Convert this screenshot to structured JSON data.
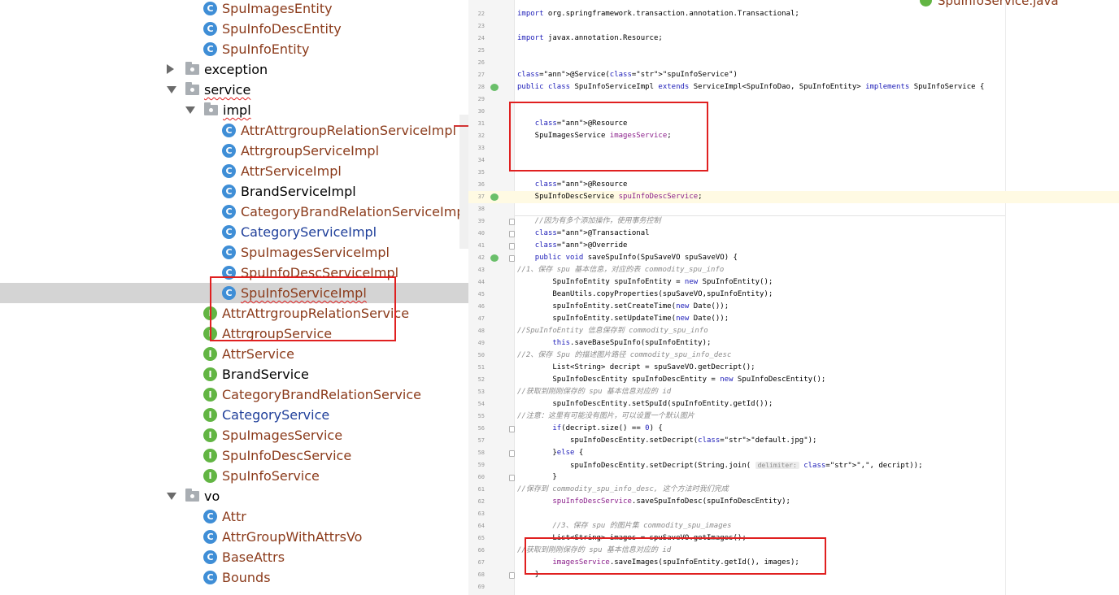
{
  "tree": {
    "rows": [
      {
        "label": "SpuImagesEntity",
        "icon": "class-icon",
        "color": "brown"
      },
      {
        "label": "SpuInfoDescEntity",
        "icon": "class-icon",
        "color": "brown"
      },
      {
        "label": "SpuInfoEntity",
        "icon": "class-icon",
        "color": "brown"
      },
      {
        "label": "exception",
        "icon": "folder-icon",
        "color": "black",
        "arrow": "right"
      },
      {
        "label": "service",
        "icon": "folder-icon",
        "color": "black",
        "arrow": "down"
      },
      {
        "label": "impl",
        "icon": "folder-icon",
        "color": "black",
        "arrow": "down"
      },
      {
        "label": "AttrAttrgroupRelationServiceImpl",
        "icon": "class-icon",
        "color": "brown"
      },
      {
        "label": "AttrgroupServiceImpl",
        "icon": "class-icon",
        "color": "brown"
      },
      {
        "label": "AttrServiceImpl",
        "icon": "class-icon",
        "color": "brown"
      },
      {
        "label": "BrandServiceImpl",
        "icon": "class-icon",
        "color": "black"
      },
      {
        "label": "CategoryBrandRelationServiceImpl",
        "icon": "class-icon",
        "color": "brown"
      },
      {
        "label": "CategoryServiceImpl",
        "icon": "class-icon",
        "color": "blue"
      },
      {
        "label": "SpuImagesServiceImpl",
        "icon": "class-icon",
        "color": "brown"
      },
      {
        "label": "SpuInfoDescServiceImpl",
        "icon": "class-icon",
        "color": "brown"
      },
      {
        "label": "SpuInfoServiceImpl",
        "icon": "class-icon",
        "color": "brown"
      },
      {
        "label": "AttrAttrgroupRelationService",
        "icon": "interface-icon",
        "color": "brown"
      },
      {
        "label": "AttrgroupService",
        "icon": "interface-icon",
        "color": "brown"
      },
      {
        "label": "AttrService",
        "icon": "interface-icon",
        "color": "brown"
      },
      {
        "label": "BrandService",
        "icon": "interface-icon",
        "color": "black"
      },
      {
        "label": "CategoryBrandRelationService",
        "icon": "interface-icon",
        "color": "brown"
      },
      {
        "label": "CategoryService",
        "icon": "interface-icon",
        "color": "blue"
      },
      {
        "label": "SpuImagesService",
        "icon": "interface-icon",
        "color": "brown"
      },
      {
        "label": "SpuInfoDescService",
        "icon": "interface-icon",
        "color": "brown"
      },
      {
        "label": "SpuInfoService",
        "icon": "interface-icon",
        "color": "brown"
      },
      {
        "label": "vo",
        "icon": "folder-icon",
        "color": "black",
        "arrow": "down"
      },
      {
        "label": "Attr",
        "icon": "class-icon",
        "color": "brown"
      },
      {
        "label": "AttrGroupWithAttrsVo",
        "icon": "class-icon",
        "color": "brown"
      },
      {
        "label": "BaseAttrs",
        "icon": "class-icon",
        "color": "brown"
      },
      {
        "label": "Bounds",
        "icon": "class-icon",
        "color": "brown"
      }
    ],
    "class_glyph": "C",
    "interface_glyph": "I"
  },
  "editor": {
    "tab_title": "SpuInfoService.java",
    "lines": [
      {
        "n": "22",
        "t": "import org.springframework.transaction.annotation.Transactional;"
      },
      {
        "n": "23",
        "t": ""
      },
      {
        "n": "24",
        "t": "import javax.annotation.Resource;"
      },
      {
        "n": "25",
        "t": ""
      },
      {
        "n": "26",
        "t": ""
      },
      {
        "n": "27",
        "t": "@Service(\"spuInfoService\")"
      },
      {
        "n": "28",
        "t": "public class SpuInfoServiceImpl extends ServiceImpl<SpuInfoDao, SpuInfoEntity> implements SpuInfoService {"
      },
      {
        "n": "29",
        "t": ""
      },
      {
        "n": "30",
        "t": ""
      },
      {
        "n": "31",
        "t": "    @Resource"
      },
      {
        "n": "32",
        "t": "    SpuImagesService imagesService;"
      },
      {
        "n": "33",
        "t": ""
      },
      {
        "n": "34",
        "t": ""
      },
      {
        "n": "35",
        "t": ""
      },
      {
        "n": "36",
        "t": "    @Resource"
      },
      {
        "n": "37",
        "t": "    SpuInfoDescService spuInfoDescService;"
      },
      {
        "n": "38",
        "t": ""
      },
      {
        "n": "39",
        "t": "    //因为有多个添加操作，使用事务控制"
      },
      {
        "n": "40",
        "t": "    @Transactional"
      },
      {
        "n": "41",
        "t": "    @Override"
      },
      {
        "n": "42",
        "t": "    public void saveSpuInfo(SpuSaveVO spuSaveVO) {"
      },
      {
        "n": "43",
        "t": "//1、保存 spu 基本信息，对应的表 commodity_spu_info"
      },
      {
        "n": "44",
        "t": "        SpuInfoEntity spuInfoEntity = new SpuInfoEntity();"
      },
      {
        "n": "45",
        "t": "        BeanUtils.copyProperties(spuSaveVO,spuInfoEntity);"
      },
      {
        "n": "46",
        "t": "        spuInfoEntity.setCreateTime(new Date());"
      },
      {
        "n": "47",
        "t": "        spuInfoEntity.setUpdateTime(new Date());"
      },
      {
        "n": "48",
        "t": "//SpuInfoEntity 信息保存到 commodity_spu_info"
      },
      {
        "n": "49",
        "t": "        this.saveBaseSpuInfo(spuInfoEntity);"
      },
      {
        "n": "50",
        "t": "//2、保存 Spu 的描述图片路径 commodity_spu_info_desc"
      },
      {
        "n": "51",
        "t": "        List<String> decript = spuSaveVO.getDecript();"
      },
      {
        "n": "52",
        "t": "        SpuInfoDescEntity spuInfoDescEntity = new SpuInfoDescEntity();"
      },
      {
        "n": "53",
        "t": "//获取到刚刚保存的 spu 基本信息对应的 id"
      },
      {
        "n": "54",
        "t": "        spuInfoDescEntity.setSpuId(spuInfoEntity.getId());"
      },
      {
        "n": "55",
        "t": "//注意：这里有可能没有图片，可以设置一个默认图片"
      },
      {
        "n": "56",
        "t": "        if(decript.size() == 0) {"
      },
      {
        "n": "57",
        "t": "            spuInfoDescEntity.setDecript(\"default.jpg\");"
      },
      {
        "n": "58",
        "t": "        }else {"
      },
      {
        "n": "59",
        "t": "            spuInfoDescEntity.setDecript(String.join( delimiter: \",\", decript));"
      },
      {
        "n": "60",
        "t": "        }"
      },
      {
        "n": "61",
        "t": "//保存到 commodity_spu_info_desc, 这个方法时我们完成"
      },
      {
        "n": "62",
        "t": "        spuInfoDescService.saveSpuInfoDesc(spuInfoDescEntity);"
      },
      {
        "n": "63",
        "t": ""
      },
      {
        "n": "64",
        "t": "        //3、保存 spu 的图片集 commodity_spu_images"
      },
      {
        "n": "65",
        "t": "        List<String> images = spuSaveVO.getImages();"
      },
      {
        "n": "66",
        "t": "//获取到刚刚保存的 spu 基本信息对应的 id"
      },
      {
        "n": "67",
        "t": "        imagesService.saveImages(spuInfoEntity.getId(), images);"
      },
      {
        "n": "68",
        "t": "    }"
      },
      {
        "n": "69",
        "t": ""
      }
    ]
  },
  "colors": {
    "highlight": "#e02020",
    "selected_row": "#d4d4d4",
    "brown_text": "#8b3b1b"
  }
}
